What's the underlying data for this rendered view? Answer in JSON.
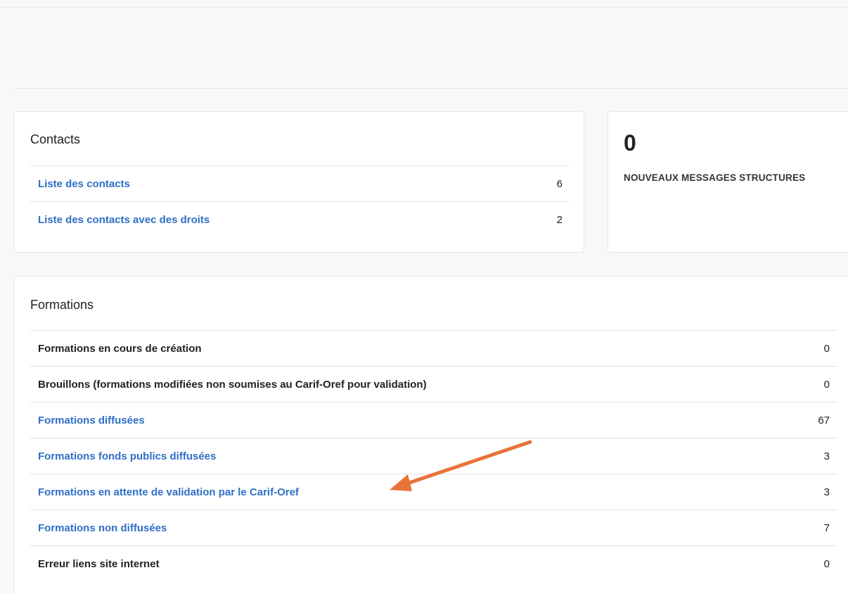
{
  "contacts": {
    "title": "Contacts",
    "items": [
      {
        "label": "Liste des contacts",
        "count": "6",
        "link": true
      },
      {
        "label": "Liste des contacts avec des droits",
        "count": "2",
        "link": true
      }
    ]
  },
  "messages": {
    "count": "0",
    "label": "NOUVEAUX MESSAGES STRUCTURES"
  },
  "formations": {
    "title": "Formations",
    "items": [
      {
        "label": "Formations en cours de création",
        "count": "0",
        "link": false
      },
      {
        "label": "Brouillons (formations modifiées non soumises au Carif-Oref pour validation)",
        "count": "0",
        "link": false
      },
      {
        "label": "Formations diffusées",
        "count": "67",
        "link": true
      },
      {
        "label": "Formations fonds publics diffusées",
        "count": "3",
        "link": true
      },
      {
        "label": "Formations en attente de validation par le Carif-Oref",
        "count": "3",
        "link": true
      },
      {
        "label": "Formations non diffusées",
        "count": "7",
        "link": true
      },
      {
        "label": "Erreur liens site internet",
        "count": "0",
        "link": false
      }
    ]
  },
  "colors": {
    "link": "#2f6fc6",
    "annotation_arrow": "#e8733a"
  },
  "annotation": {
    "icon": "arrow-annotation-icon"
  }
}
